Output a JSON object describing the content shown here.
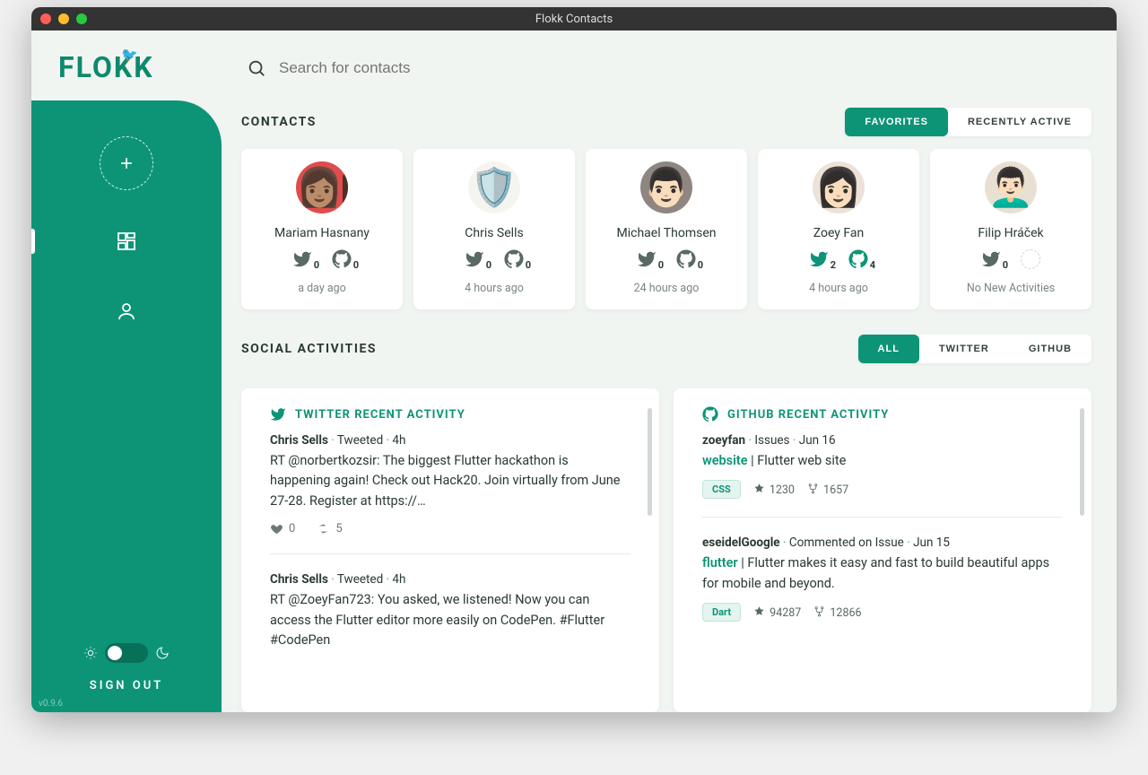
{
  "window": {
    "title": "Flokk Contacts"
  },
  "logo": "FLOKK",
  "sidebar": {
    "signout": "SIGN OUT",
    "version": "v0.9.6"
  },
  "search": {
    "placeholder": "Search for contacts"
  },
  "sections": {
    "contacts": "CONTACTS",
    "activities": "SOCIAL ACTIVITIES"
  },
  "tabs": {
    "contacts": [
      {
        "label": "FAVORITES",
        "active": true
      },
      {
        "label": "RECENTLY ACTIVE",
        "active": false
      }
    ],
    "activities": [
      {
        "label": "ALL",
        "active": true
      },
      {
        "label": "TWITTER",
        "active": false
      },
      {
        "label": "GITHUB",
        "active": false
      }
    ]
  },
  "contacts": [
    {
      "name": "Mariam Hasnany",
      "twitter": 0,
      "github": 0,
      "time": "a day ago",
      "active": false,
      "gh_present": true
    },
    {
      "name": "Chris Sells",
      "twitter": 0,
      "github": 0,
      "time": "4 hours ago",
      "active": false,
      "gh_present": true
    },
    {
      "name": "Michael Thomsen",
      "twitter": 0,
      "github": 0,
      "time": "24 hours ago",
      "active": false,
      "gh_present": true
    },
    {
      "name": "Zoey Fan",
      "twitter": 2,
      "github": 4,
      "time": "4 hours ago",
      "active": true,
      "gh_present": true
    },
    {
      "name": "Filip Hráček",
      "twitter": 0,
      "github": null,
      "time": "No New Activities",
      "active": false,
      "gh_present": false
    }
  ],
  "twitter_panel": {
    "title": "TWITTER RECENT ACTIVITY",
    "items": [
      {
        "author": "Chris Sells",
        "action": "Tweeted",
        "when": "4h",
        "text": "RT @norbertkozsir: The biggest Flutter hackathon is happening again! Check out Hack20. Join virtually from June 27-28. Register at https://…",
        "likes": 0,
        "retweets": 5
      },
      {
        "author": "Chris Sells",
        "action": "Tweeted",
        "when": "4h",
        "text": "RT @ZoeyFan723: You asked, we listened! Now you can access the Flutter editor more easily on CodePen. #Flutter #CodePen"
      }
    ]
  },
  "github_panel": {
    "title": "GITHUB RECENT ACTIVITY",
    "items": [
      {
        "author": "zoeyfan",
        "action": "Issues",
        "when": "Jun 16",
        "repo": "website",
        "desc": "Flutter web site",
        "lang": "CSS",
        "stars": 1230,
        "forks": 1657
      },
      {
        "author": "eseidelGoogle",
        "action": "Commented on Issue",
        "when": "Jun 15",
        "repo": "flutter",
        "desc": "Flutter makes it easy and fast to build beautiful apps for mobile and beyond.",
        "lang": "Dart",
        "stars": 94287,
        "forks": 12866
      }
    ]
  }
}
